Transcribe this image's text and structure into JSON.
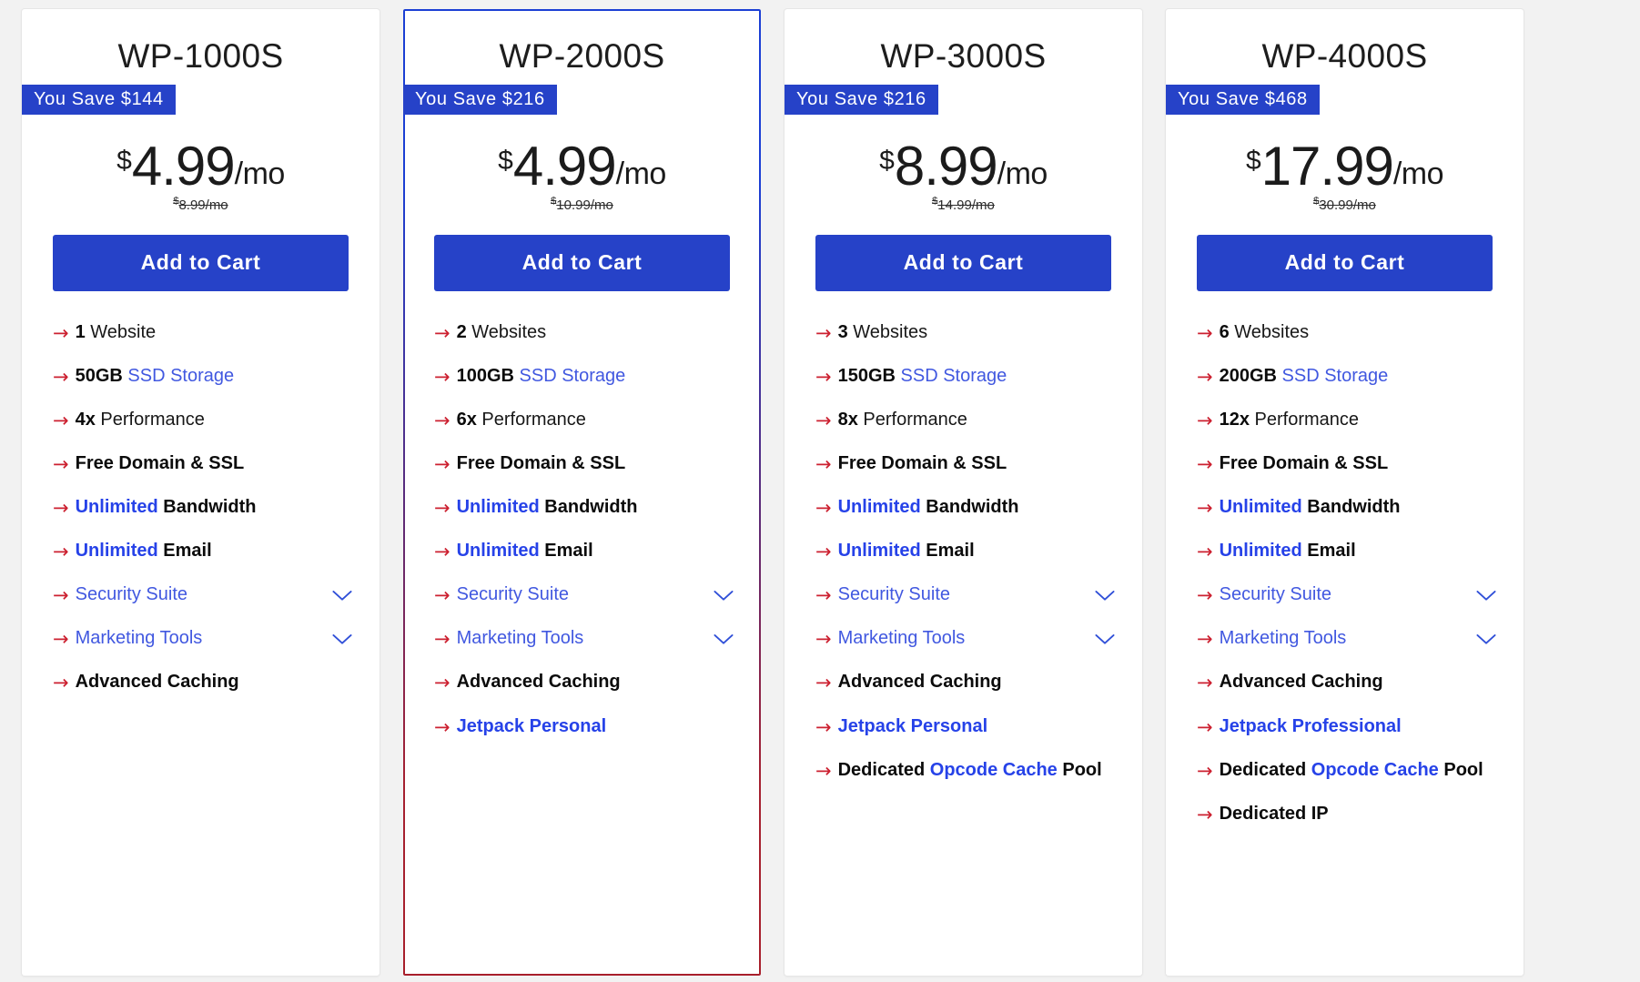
{
  "page": {
    "background": "#f2f2f2",
    "accent_blue": "#2642c8",
    "link_blue": "#4158e0",
    "arrow_red": "#cc2030",
    "featured_border_top": "#1b3fd4",
    "featured_border_bottom": "#a81f2b"
  },
  "icons": {
    "arrow": "→",
    "chevron_down": "chevron-down-icon"
  },
  "plans": [
    {
      "id": "wp-1000s",
      "name": "WP-1000S",
      "featured": false,
      "save_badge": "You Save $144",
      "currency": "$",
      "price": "4.99",
      "period": "/mo",
      "old_currency": "$",
      "old_price": "8.99/mo",
      "cta": "Add to Cart",
      "features": [
        {
          "parts": [
            {
              "text": "1",
              "style": "bold"
            },
            {
              "text": " Website",
              "style": "norm"
            }
          ],
          "chevron": false
        },
        {
          "parts": [
            {
              "text": "50GB",
              "style": "bold"
            },
            {
              "text": " SSD Storage",
              "style": "blue"
            }
          ],
          "chevron": false
        },
        {
          "parts": [
            {
              "text": "4x",
              "style": "bold"
            },
            {
              "text": " Performance",
              "style": "norm"
            }
          ],
          "chevron": false
        },
        {
          "parts": [
            {
              "text": "Free Domain & SSL",
              "style": "bold"
            }
          ],
          "chevron": false
        },
        {
          "parts": [
            {
              "text": "Unlimited",
              "style": "blueb"
            },
            {
              "text": " Bandwidth",
              "style": "bold"
            }
          ],
          "chevron": false
        },
        {
          "parts": [
            {
              "text": "Unlimited",
              "style": "blueb"
            },
            {
              "text": " Email",
              "style": "bold"
            }
          ],
          "chevron": false
        },
        {
          "parts": [
            {
              "text": "Security Suite",
              "style": "blue"
            }
          ],
          "chevron": true
        },
        {
          "parts": [
            {
              "text": "Marketing Tools",
              "style": "blue"
            }
          ],
          "chevron": true
        },
        {
          "parts": [
            {
              "text": "Advanced Caching",
              "style": "bold"
            }
          ],
          "chevron": false
        }
      ]
    },
    {
      "id": "wp-2000s",
      "name": "WP-2000S",
      "featured": true,
      "save_badge": "You Save $216",
      "currency": "$",
      "price": "4.99",
      "period": "/mo",
      "old_currency": "$",
      "old_price": "10.99/mo",
      "cta": "Add to Cart",
      "features": [
        {
          "parts": [
            {
              "text": "2",
              "style": "bold"
            },
            {
              "text": " Websites",
              "style": "norm"
            }
          ],
          "chevron": false
        },
        {
          "parts": [
            {
              "text": "100GB",
              "style": "bold"
            },
            {
              "text": " SSD Storage",
              "style": "blue"
            }
          ],
          "chevron": false
        },
        {
          "parts": [
            {
              "text": "6x",
              "style": "bold"
            },
            {
              "text": " Performance",
              "style": "norm"
            }
          ],
          "chevron": false
        },
        {
          "parts": [
            {
              "text": "Free Domain & SSL",
              "style": "bold"
            }
          ],
          "chevron": false
        },
        {
          "parts": [
            {
              "text": "Unlimited",
              "style": "blueb"
            },
            {
              "text": " Bandwidth",
              "style": "bold"
            }
          ],
          "chevron": false
        },
        {
          "parts": [
            {
              "text": "Unlimited",
              "style": "blueb"
            },
            {
              "text": " Email",
              "style": "bold"
            }
          ],
          "chevron": false
        },
        {
          "parts": [
            {
              "text": "Security Suite",
              "style": "blue"
            }
          ],
          "chevron": true
        },
        {
          "parts": [
            {
              "text": "Marketing Tools",
              "style": "blue"
            }
          ],
          "chevron": true
        },
        {
          "parts": [
            {
              "text": "Advanced Caching",
              "style": "bold"
            }
          ],
          "chevron": false
        },
        {
          "parts": [
            {
              "text": "Jetpack Personal",
              "style": "blueb"
            }
          ],
          "chevron": false
        }
      ]
    },
    {
      "id": "wp-3000s",
      "name": "WP-3000S",
      "featured": false,
      "save_badge": "You Save $216",
      "currency": "$",
      "price": "8.99",
      "period": "/mo",
      "old_currency": "$",
      "old_price": "14.99/mo",
      "cta": "Add to Cart",
      "features": [
        {
          "parts": [
            {
              "text": "3",
              "style": "bold"
            },
            {
              "text": " Websites",
              "style": "norm"
            }
          ],
          "chevron": false
        },
        {
          "parts": [
            {
              "text": "150GB",
              "style": "bold"
            },
            {
              "text": " SSD Storage",
              "style": "blue"
            }
          ],
          "chevron": false
        },
        {
          "parts": [
            {
              "text": "8x",
              "style": "bold"
            },
            {
              "text": " Performance",
              "style": "norm"
            }
          ],
          "chevron": false
        },
        {
          "parts": [
            {
              "text": "Free Domain & SSL",
              "style": "bold"
            }
          ],
          "chevron": false
        },
        {
          "parts": [
            {
              "text": "Unlimited",
              "style": "blueb"
            },
            {
              "text": " Bandwidth",
              "style": "bold"
            }
          ],
          "chevron": false
        },
        {
          "parts": [
            {
              "text": "Unlimited",
              "style": "blueb"
            },
            {
              "text": " Email",
              "style": "bold"
            }
          ],
          "chevron": false
        },
        {
          "parts": [
            {
              "text": "Security Suite",
              "style": "blue"
            }
          ],
          "chevron": true
        },
        {
          "parts": [
            {
              "text": "Marketing Tools",
              "style": "blue"
            }
          ],
          "chevron": true
        },
        {
          "parts": [
            {
              "text": "Advanced Caching",
              "style": "bold"
            }
          ],
          "chevron": false
        },
        {
          "parts": [
            {
              "text": "Jetpack Personal",
              "style": "blueb"
            }
          ],
          "chevron": false
        },
        {
          "parts": [
            {
              "text": "Dedicated ",
              "style": "bold"
            },
            {
              "text": "Opcode Cache",
              "style": "blueb"
            },
            {
              "text": " Pool",
              "style": "bold"
            }
          ],
          "chevron": false
        }
      ]
    },
    {
      "id": "wp-4000s",
      "name": "WP-4000S",
      "featured": false,
      "save_badge": "You Save $468",
      "currency": "$",
      "price": "17.99",
      "period": "/mo",
      "old_currency": "$",
      "old_price": "30.99/mo",
      "cta": "Add to Cart",
      "features": [
        {
          "parts": [
            {
              "text": "6",
              "style": "bold"
            },
            {
              "text": " Websites",
              "style": "norm"
            }
          ],
          "chevron": false
        },
        {
          "parts": [
            {
              "text": "200GB",
              "style": "bold"
            },
            {
              "text": " SSD Storage",
              "style": "blue"
            }
          ],
          "chevron": false
        },
        {
          "parts": [
            {
              "text": "12x",
              "style": "bold"
            },
            {
              "text": " Performance",
              "style": "norm"
            }
          ],
          "chevron": false
        },
        {
          "parts": [
            {
              "text": "Free Domain & SSL",
              "style": "bold"
            }
          ],
          "chevron": false
        },
        {
          "parts": [
            {
              "text": "Unlimited",
              "style": "blueb"
            },
            {
              "text": " Bandwidth",
              "style": "bold"
            }
          ],
          "chevron": false
        },
        {
          "parts": [
            {
              "text": "Unlimited",
              "style": "blueb"
            },
            {
              "text": " Email",
              "style": "bold"
            }
          ],
          "chevron": false
        },
        {
          "parts": [
            {
              "text": "Security Suite",
              "style": "blue"
            }
          ],
          "chevron": true
        },
        {
          "parts": [
            {
              "text": "Marketing Tools",
              "style": "blue"
            }
          ],
          "chevron": true
        },
        {
          "parts": [
            {
              "text": "Advanced Caching",
              "style": "bold"
            }
          ],
          "chevron": false
        },
        {
          "parts": [
            {
              "text": "Jetpack Professional",
              "style": "blueb"
            }
          ],
          "chevron": false
        },
        {
          "parts": [
            {
              "text": "Dedicated ",
              "style": "bold"
            },
            {
              "text": "Opcode Cache",
              "style": "blueb"
            },
            {
              "text": " Pool",
              "style": "bold"
            }
          ],
          "chevron": false
        },
        {
          "parts": [
            {
              "text": "Dedicated IP",
              "style": "bold"
            }
          ],
          "chevron": false
        }
      ]
    }
  ]
}
